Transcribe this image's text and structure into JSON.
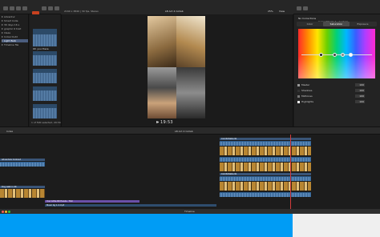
{
  "viewer": {
    "format_label": "2160 x 3840 | 30 fps, Stereo",
    "project_name": "LB Act 4 Collab",
    "zoom": "25%",
    "view_label": "View",
    "timecode": "19:53"
  },
  "sidebar": {
    "items": [
      {
        "label": "Adventur"
      },
      {
        "label": "Smart Colle"
      },
      {
        "label": "30 days 16 s"
      },
      {
        "label": "graphic 6 trait"
      },
      {
        "label": "Ideas"
      },
      {
        "label": "IndoorOutd"
      },
      {
        "label": "Light Bulb"
      },
      {
        "label": "Timeline file"
      }
    ]
  },
  "browser": {
    "clips": [
      {
        "label": "Oh you there"
      }
    ],
    "selection_status": "1 of 500 selected, 29:34"
  },
  "inspector": {
    "title": "No Corrections",
    "preset": "Color Wheels 1 - Custom",
    "tabs": [
      {
        "label": "Color"
      },
      {
        "label": "Saturation"
      },
      {
        "label": "Exposure"
      }
    ],
    "rows": [
      {
        "label": "Master",
        "value": "100"
      },
      {
        "label": "Shadows",
        "value": "100"
      },
      {
        "label": "Midtones",
        "value": "100"
      },
      {
        "label": "Highlights",
        "value": "100"
      }
    ]
  },
  "timeline": {
    "index_label": "Index",
    "project": "LB Act 4 Collab",
    "clips": {
      "title_left": "Adventure Cookout",
      "clip_left_a": "Dog walk in 4K",
      "clip_right_a": "Comfortable lib",
      "clip_right_b": "Comfortable lib",
      "purple_label": "Your Little Bit Hands - Trim",
      "blue_label": "Music bg 1.4 mp3"
    }
  },
  "dock": {
    "label": "Timeline"
  },
  "colors": {
    "accent_blue": "#009cf5",
    "selection": "#4b5d7e"
  }
}
